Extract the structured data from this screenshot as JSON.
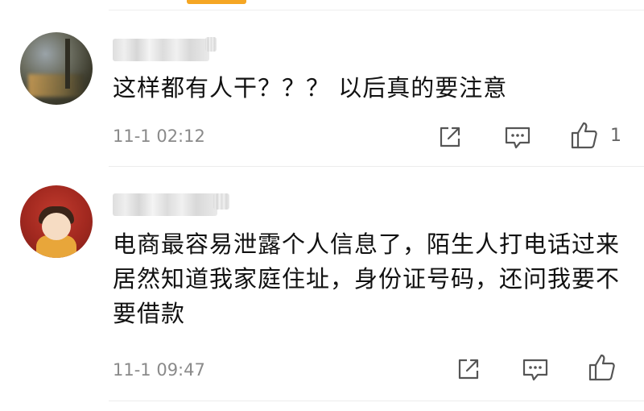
{
  "comments": [
    {
      "text": "这样都有人干？？？ 以后真的要注意",
      "timestamp": "11-1 02:12",
      "like_count": "1"
    },
    {
      "text": "电商最容易泄露个人信息了，陌生人打电话过来居然知道我家庭住址，身份证号码，还问我要不要借款",
      "timestamp": "11-1 09:47",
      "like_count": ""
    }
  ],
  "icons": {
    "share": "share-icon",
    "reply": "comment-icon",
    "like": "thumbs-up-icon"
  },
  "colors": {
    "accent": "#f5a623",
    "timestamp": "#8a8a8a",
    "text": "#111111"
  }
}
